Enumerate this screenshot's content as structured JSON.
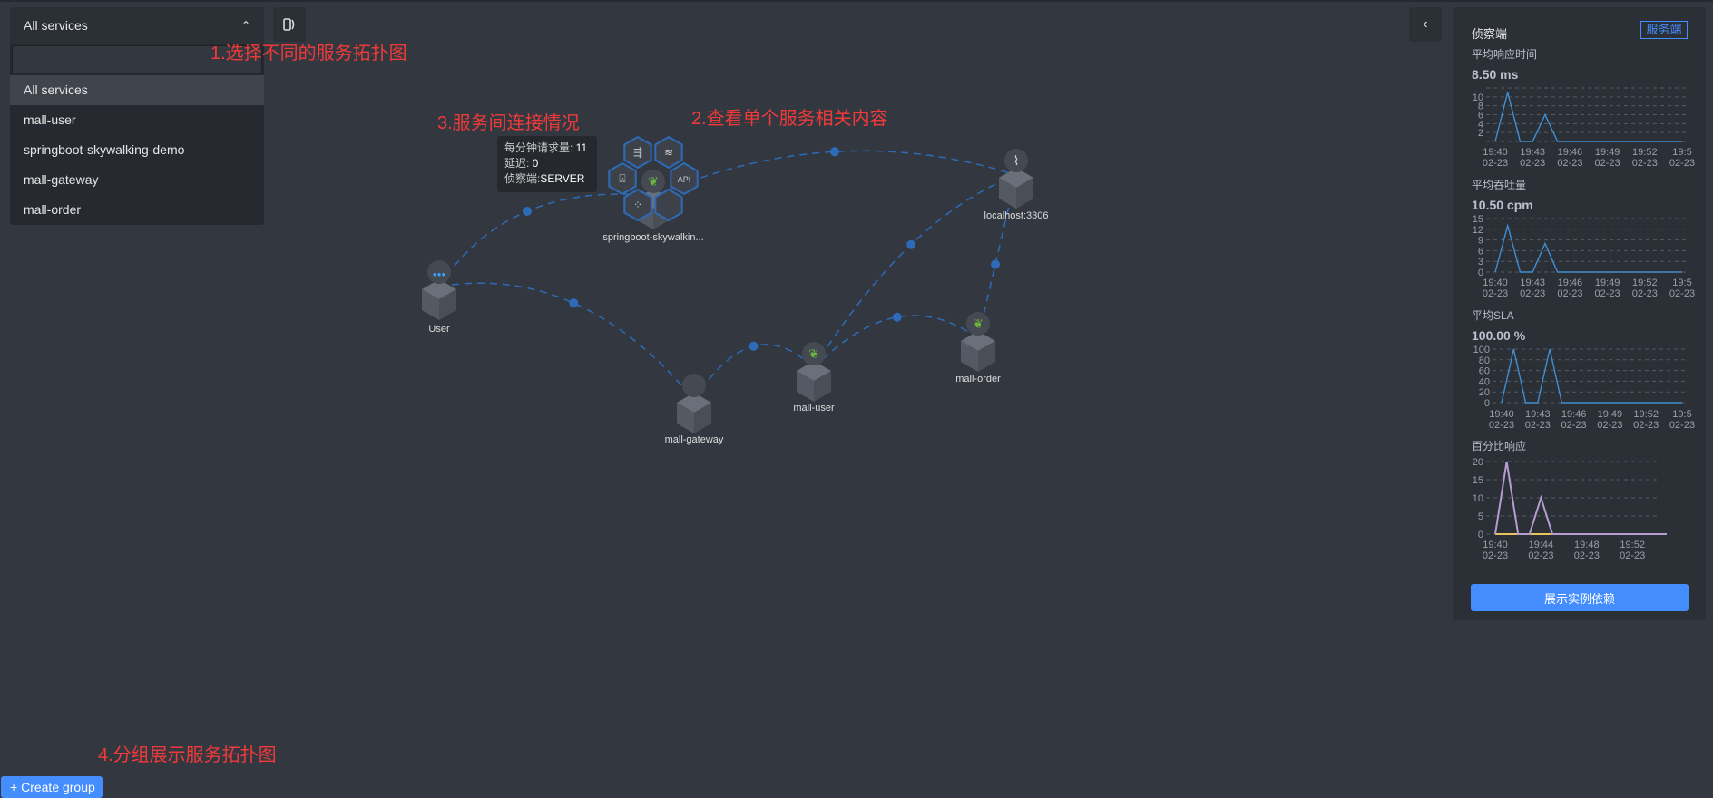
{
  "service_select": {
    "selected": "All services",
    "search_value": "",
    "options": [
      "All services",
      "mall-user",
      "springboot-skywalking-demo",
      "mall-gateway",
      "mall-order"
    ]
  },
  "annotations": {
    "a1": "1.选择不同的服务拓扑图",
    "a2": "2.查看单个服务相关内容",
    "a3": "3.服务间连接情况",
    "a4": "4.分组展示服务拓扑图"
  },
  "create_group": "Create group",
  "tooltip": {
    "cpm_label": "每分钟请求量: ",
    "cpm": "11",
    "latency_label": "延迟: ",
    "latency": "0",
    "detect_label": "侦察端:",
    "detect": "SERVER"
  },
  "topology": {
    "nodes": [
      {
        "id": "User",
        "label": "User",
        "icon": "users-icon"
      },
      {
        "id": "springboot",
        "label": "springboot-skywalkin...",
        "icon": "spring-leaf-icon"
      },
      {
        "id": "localhost",
        "label": "localhost:3306",
        "icon": "mysql-dolphin-icon"
      },
      {
        "id": "gateway",
        "label": "mall-gateway",
        "icon": "gateway-icon"
      },
      {
        "id": "user",
        "label": "mall-user",
        "icon": "spring-leaf-icon"
      },
      {
        "id": "order",
        "label": "mall-order",
        "icon": "spring-leaf-icon"
      }
    ],
    "edges": [
      [
        "User",
        "springboot"
      ],
      [
        "springboot",
        "localhost"
      ],
      [
        "User",
        "gateway"
      ],
      [
        "gateway",
        "user"
      ],
      [
        "user",
        "localhost"
      ],
      [
        "user",
        "order"
      ],
      [
        "order",
        "localhost"
      ]
    ],
    "hex_menu_icons": [
      "endpoint-icon",
      "database-icon",
      "alarm-icon",
      "api-icon",
      "instance-icon",
      "blank"
    ],
    "accent": "#2d6bb8"
  },
  "side_panel": {
    "title": "侦察端",
    "badge": "服务端",
    "button": "展示实例依赖",
    "metrics": [
      {
        "label": "平均响应时间",
        "value": "8.50 ms"
      },
      {
        "label": "平均吞吐量",
        "value": "10.50 cpm"
      },
      {
        "label": "平均SLA",
        "value": "100.00 %"
      },
      {
        "label": "百分比响应",
        "value": ""
      }
    ]
  },
  "chart_data": [
    {
      "type": "line",
      "title": "平均响应时间",
      "x": [
        "19:40",
        "19:41",
        "19:42",
        "19:43",
        "19:44",
        "19:45",
        "19:46",
        "19:47",
        "19:48",
        "19:49",
        "19:50",
        "19:51",
        "19:52",
        "19:53",
        "19:54",
        "19:55"
      ],
      "series": [
        {
          "color": "#3f8fd2",
          "values": [
            0,
            11,
            0,
            0,
            6,
            0,
            0,
            0,
            0,
            0,
            0,
            0,
            0,
            0,
            0,
            0
          ]
        }
      ],
      "yticks": [
        "2",
        "4",
        "6",
        "8",
        "10"
      ],
      "ylim": [
        0,
        12
      ],
      "xticks": [
        "19:40",
        "19:43",
        "19:46",
        "19:49",
        "19:52",
        "19:5"
      ],
      "xdate": "02-23",
      "grid": true
    },
    {
      "type": "line",
      "title": "平均吞吐量",
      "x": [
        "19:40",
        "19:41",
        "19:42",
        "19:43",
        "19:44",
        "19:45",
        "19:46",
        "19:47",
        "19:48",
        "19:49",
        "19:50",
        "19:51",
        "19:52",
        "19:53",
        "19:54",
        "19:55"
      ],
      "series": [
        {
          "color": "#3f8fd2",
          "values": [
            0,
            13,
            0,
            0,
            8,
            0,
            0,
            0,
            0,
            0,
            0,
            0,
            0,
            0,
            0,
            0
          ]
        }
      ],
      "yticks": [
        "0",
        "3",
        "6",
        "9",
        "12",
        "15"
      ],
      "ylim": [
        0,
        15
      ],
      "xticks": [
        "19:40",
        "19:43",
        "19:46",
        "19:49",
        "19:52",
        "19:5"
      ],
      "xdate": "02-23",
      "grid": true
    },
    {
      "type": "line",
      "title": "平均SLA",
      "x": [
        "19:40",
        "19:41",
        "19:42",
        "19:43",
        "19:44",
        "19:45",
        "19:46",
        "19:47",
        "19:48",
        "19:49",
        "19:50",
        "19:51",
        "19:52",
        "19:53",
        "19:54",
        "19:55"
      ],
      "series": [
        {
          "color": "#3f8fd2",
          "values": [
            0,
            100,
            0,
            0,
            100,
            0,
            0,
            0,
            0,
            0,
            0,
            0,
            0,
            0,
            0,
            0
          ]
        }
      ],
      "yticks": [
        "0",
        "20",
        "40",
        "60",
        "80",
        "100"
      ],
      "ylim": [
        0,
        100
      ],
      "xticks": [
        "19:40",
        "19:43",
        "19:46",
        "19:49",
        "19:52",
        "19:5"
      ],
      "xdate": "02-23",
      "grid": true
    },
    {
      "type": "line",
      "title": "百分比响应",
      "x": [
        "19:40",
        "19:41",
        "19:42",
        "19:43",
        "19:44",
        "19:45",
        "19:46",
        "19:47",
        "19:48",
        "19:49",
        "19:50",
        "19:51",
        "19:52",
        "19:53",
        "19:54",
        "19:55"
      ],
      "series": [
        {
          "color": "#3f8fd2",
          "values": [
            0,
            0,
            0,
            0,
            0,
            0,
            0,
            0,
            0,
            0,
            0,
            0,
            0,
            0,
            0,
            0
          ]
        },
        {
          "color": "#e6c35c",
          "values": [
            0,
            0,
            0,
            0,
            0,
            0,
            0,
            0,
            0,
            0,
            0,
            0,
            0,
            0,
            0,
            0
          ]
        },
        {
          "color": "#b79cd0",
          "values": [
            0,
            20,
            0,
            0,
            10,
            0,
            0,
            0,
            0,
            0,
            0,
            0,
            0,
            0,
            0,
            0
          ]
        }
      ],
      "yticks": [
        "0",
        "5",
        "10",
        "15",
        "20"
      ],
      "ylim": [
        0,
        20
      ],
      "xticks": [
        "19:40",
        "19:44",
        "19:48",
        "19:52"
      ],
      "xdate": "02-23",
      "grid": true
    }
  ]
}
